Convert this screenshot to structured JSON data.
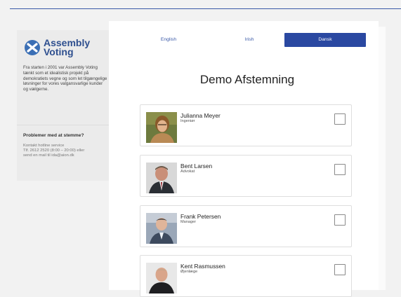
{
  "brand": {
    "line1": "Assembly",
    "line2": "Voting"
  },
  "sidebar": {
    "intro": "Fra starten i 2001 var Assembly Voting tænkt som et idealistisk projekt på demokratiets vegne og som let tilgængelige løsninger for vores valgansvarlige kunder og vælgerne.",
    "problem_title": "Problemer med at stemme?",
    "contact_line1": "Kontakt hotline service",
    "contact_line2": "Tlf. 2612 2520 (8:00 – 20:00) eller",
    "contact_line3": "send en mail til ida@aion.dk"
  },
  "languages": {
    "english": "English",
    "irish": "Irish",
    "danish": "Dansk"
  },
  "page_title": "Demo Afstemning",
  "candidates": [
    {
      "name": "Julianna Meyer",
      "role": "Ingeniør"
    },
    {
      "name": "Bent Larsen",
      "role": "Advokat"
    },
    {
      "name": "Frank Petersen",
      "role": "Manager"
    },
    {
      "name": "Kent Rasmussen",
      "role": "Øjenlæge"
    }
  ],
  "colors": {
    "accent": "#2a48a1",
    "brand": "#3b6fb5",
    "link": "#3b5aa8"
  }
}
